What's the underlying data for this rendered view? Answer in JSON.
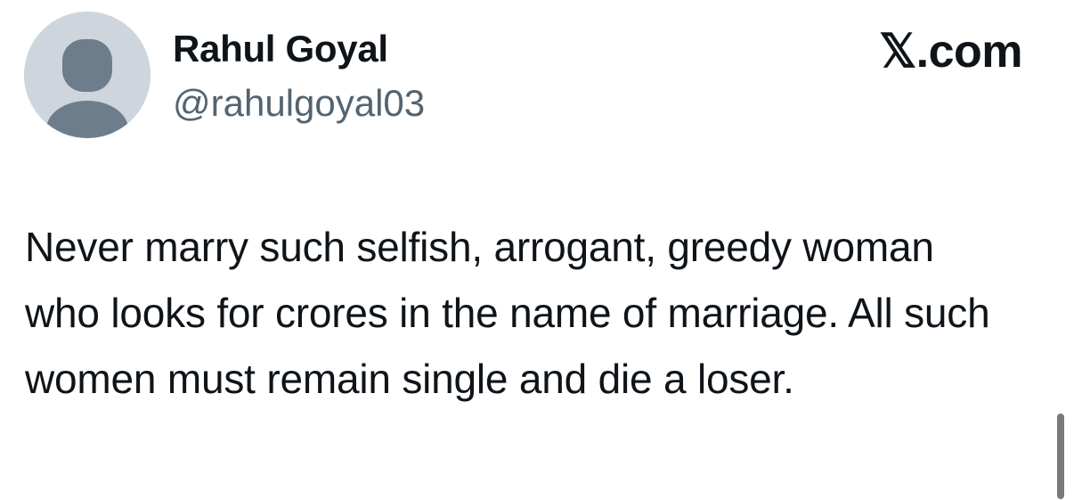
{
  "author": {
    "display_name": "Rahul Goyal",
    "handle": "@rahulgoyal03",
    "avatar_icon": "default-profile-person-icon"
  },
  "brand": {
    "label": "𝕏.com"
  },
  "tweet": {
    "text": "Never marry such selfish, arrogant, greedy woman who looks for crores in the name of marriage. All such women must remain single and die a loser."
  },
  "colors": {
    "text": "#0f1419",
    "secondary_text": "#536471",
    "avatar_background": "#ced5dd",
    "avatar_figure": "#6e7d8b",
    "scrollbar": "#7a7a7a"
  }
}
